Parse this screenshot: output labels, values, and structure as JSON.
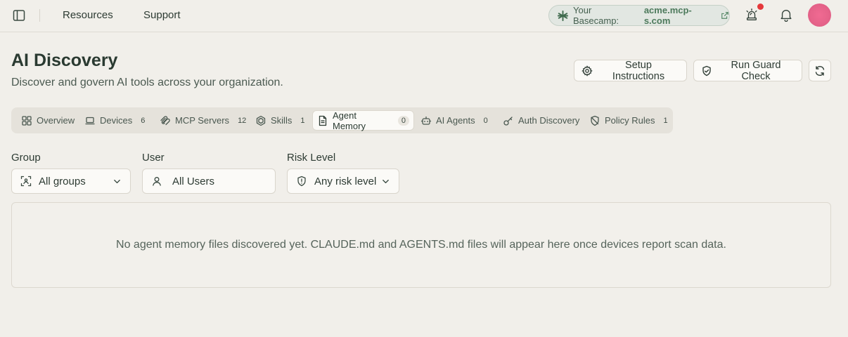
{
  "topbar": {
    "nav": [
      "Resources",
      "Support"
    ],
    "basecamp_label": "Your Basecamp:",
    "basecamp_domain": "acme.mcp-s.com"
  },
  "header": {
    "title": "AI Discovery",
    "subtitle": "Discover and govern AI tools across your organization.",
    "setup_label": "Setup Instructions",
    "guard_label": "Run Guard Check"
  },
  "tabs": [
    {
      "label": "Overview",
      "icon": "grid-icon"
    },
    {
      "label": "Devices",
      "count": "6",
      "icon": "laptop-icon"
    },
    {
      "label": "MCP Servers",
      "count": "12",
      "icon": "mcp-icon"
    },
    {
      "label": "Skills",
      "count": "1",
      "icon": "hexagon-icon"
    },
    {
      "label": "Agent Memory",
      "count": "0",
      "icon": "document-icon",
      "active": true
    },
    {
      "label": "AI Agents",
      "count": "0",
      "icon": "bot-icon"
    },
    {
      "label": "Auth Discovery",
      "icon": "key-icon"
    },
    {
      "label": "Policy Rules",
      "count": "1",
      "icon": "shield-slash-icon"
    }
  ],
  "filters": {
    "group_label": "Group",
    "group_value": "All groups",
    "user_label": "User",
    "user_value": "All Users",
    "risk_label": "Risk Level",
    "risk_value": "Any risk level"
  },
  "empty_message": "No agent memory files discovered yet. CLAUDE.md and AGENTS.md files will appear here once devices report scan data.",
  "colors": {
    "background": "#f1efea",
    "accent_green": "#4d7a5c",
    "notification_dot": "#e5383b",
    "avatar": "#e6638a"
  }
}
